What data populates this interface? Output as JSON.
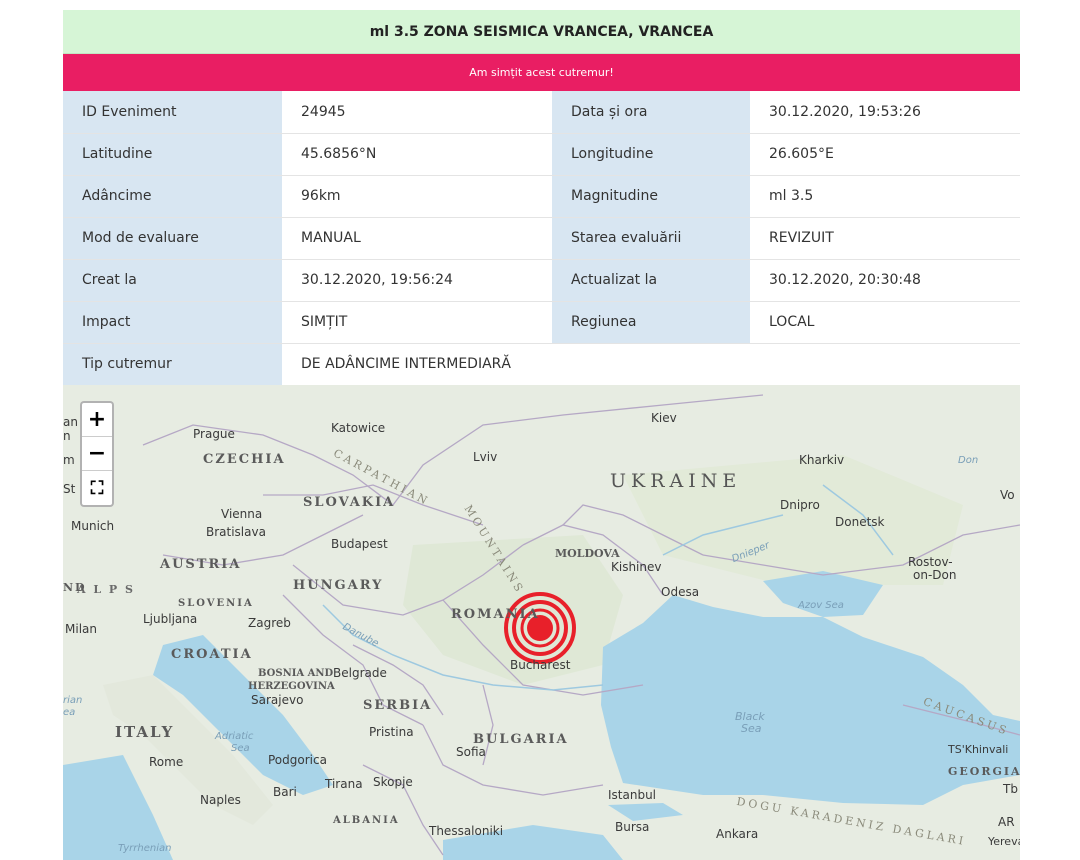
{
  "header": {
    "title": "ml 3.5 ZONA SEISMICA VRANCEA, VRANCEA",
    "felt_button": "Am simțit acest cutremur!"
  },
  "details": {
    "event_id": {
      "label": "ID Eveniment",
      "value": "24945"
    },
    "datetime": {
      "label": "Data și ora",
      "value": "30.12.2020, 19:53:26"
    },
    "latitude": {
      "label": "Latitudine",
      "value": "45.6856°N"
    },
    "longitude": {
      "label": "Longitudine",
      "value": "26.605°E"
    },
    "depth": {
      "label": "Adâncime",
      "value": "96km"
    },
    "magnitude": {
      "label": "Magnitudine",
      "value": "ml 3.5"
    },
    "eval_mode": {
      "label": "Mod de evaluare",
      "value": "MANUAL"
    },
    "eval_status": {
      "label": "Starea evaluării",
      "value": "REVIZUIT"
    },
    "created": {
      "label": "Creat la",
      "value": "30.12.2020, 19:56:24"
    },
    "updated": {
      "label": "Actualizat la",
      "value": "30.12.2020, 20:30:48"
    },
    "impact": {
      "label": "Impact",
      "value": "SIMȚIT"
    },
    "region": {
      "label": "Regiunea",
      "value": "LOCAL"
    },
    "quake_type": {
      "label": "Tip cutremur",
      "value": "DE ADÂNCIME INTERMEDIARĂ"
    }
  },
  "map": {
    "zoom_in": "+",
    "zoom_out": "−",
    "fullscreen": "⛶",
    "countries": {
      "czechia": "CZECHIA",
      "slovakia": "SLOVAKIA",
      "ukraine": "UKRAINE",
      "austria": "AUSTRIA",
      "hungary": "HUNGARY",
      "slovenia": "SLOVENIA",
      "croatia": "CROATIA",
      "bosnia1": "BOSNIA AND",
      "bosnia2": "HERZEGOVINA",
      "serbia": "SERBIA",
      "romania": "ROMANIA",
      "moldova": "MOLDOVA",
      "bulgaria": "BULGARIA",
      "italy": "ITALY",
      "albania": "ALBANIA",
      "georgia": "GEORGIA",
      "alps": "A L P S"
    },
    "cities": {
      "prague": "Prague",
      "katowice": "Katowice",
      "kiev": "Kiev",
      "lviv": "Lviv",
      "kharkiv": "Kharkiv",
      "dnipro": "Dnipro",
      "donetsk": "Donetsk",
      "rostov1": "Rostov-",
      "rostov2": "on-Don",
      "vienna": "Vienna",
      "bratislava": "Bratislava",
      "munich": "Munich",
      "budapest": "Budapest",
      "kishinev": "Kishinev",
      "odesa": "Odesa",
      "ljubljana": "Ljubljana",
      "zagreb": "Zagreb",
      "milan": "Milan",
      "belgrade": "Belgrade",
      "sarajevo": "Sarajevo",
      "bucharest": "Bucharest",
      "pristina": "Pristina",
      "sofia": "Sofia",
      "podgorica": "Podgorica",
      "rome": "Rome",
      "naples": "Naples",
      "bari": "Bari",
      "tirana": "Tirana",
      "skopje": "Skopje",
      "istanbul": "Istanbul",
      "bursa": "Bursa",
      "ankara": "Ankara",
      "thessaloniki": "Thessaloniki",
      "yerevan": "Yereva",
      "tskhinvali": "TS'Khinvali"
    },
    "water": {
      "black_sea1": "Black",
      "black_sea2": "Sea",
      "azov_sea": "Azov Sea",
      "adriatic1": "Adriatic",
      "adriatic2": "Sea",
      "danube": "Danube",
      "dnieper": "Dnieper",
      "tyrrhenian": "Tyrrhenian",
      "don": "Don"
    },
    "ranges": {
      "carpathian1": "CARPATHIAN",
      "carpathian2": "MOUNTAINS",
      "caucasus": "CAUCASUS",
      "dogu": "DOGU KARADENIZ DAGLARI"
    },
    "edge": {
      "vo": "Vo",
      "ar": "AR",
      "tb": "Tb",
      "nd": "ND",
      "am": "m",
      "st": "St",
      "an": "an",
      "h": "n",
      "rian": "rian",
      "ea": "ea"
    },
    "marker_color": "#e8202a"
  }
}
